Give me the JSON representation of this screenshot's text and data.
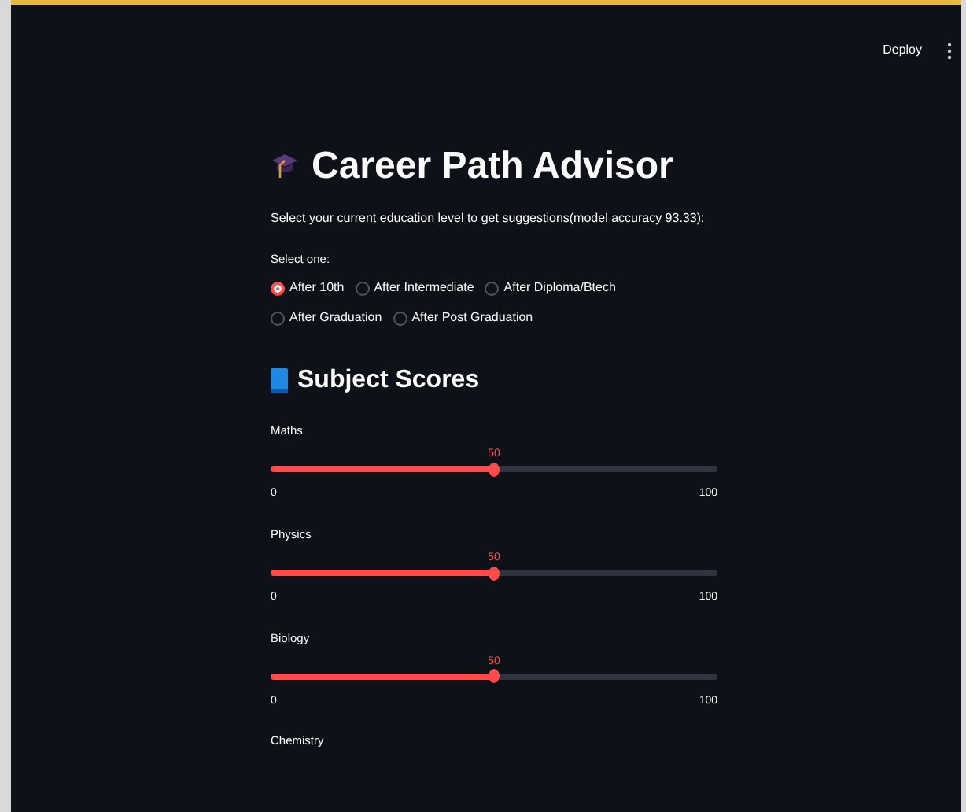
{
  "toolbar": {
    "deploy": "Deploy"
  },
  "title": "Career Path Advisor",
  "caption": "Select your current education level to get suggestions(model accuracy 93.33):",
  "radio": {
    "label": "Select one:",
    "options": [
      {
        "label": "After 10th",
        "selected": true
      },
      {
        "label": "After Intermediate",
        "selected": false
      },
      {
        "label": "After Diploma/Btech",
        "selected": false
      },
      {
        "label": "After Graduation",
        "selected": false
      },
      {
        "label": "After Post Graduation",
        "selected": false
      }
    ]
  },
  "section_title": "Subject Scores",
  "sliders": [
    {
      "label": "Maths",
      "value": "50",
      "level": 0.5,
      "min": "0",
      "max": "100"
    },
    {
      "label": "Physics",
      "value": "50",
      "level": 0.5,
      "min": "0",
      "max": "100"
    },
    {
      "label": "Biology",
      "value": "50",
      "level": 0.5,
      "min": "0",
      "max": "100"
    },
    {
      "label": "Chemistry"
    }
  ]
}
